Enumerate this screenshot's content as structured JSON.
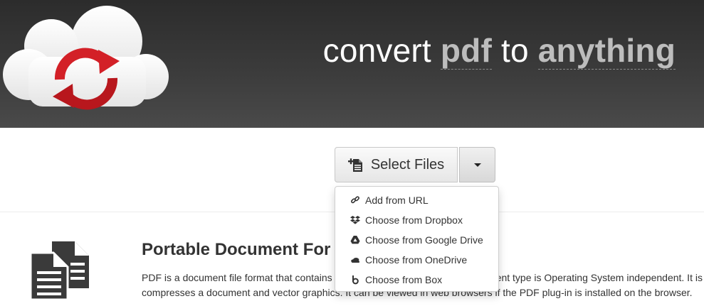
{
  "header": {
    "tagline_words": {
      "w1": "convert",
      "w2": "pdf",
      "w3": "to",
      "w4": "anything"
    },
    "colors": {
      "logo_red": "#d32027",
      "highlight_text": "#bdbdbd"
    }
  },
  "toolbar": {
    "select_files_label": "Select Files",
    "select_icon": "file-add-icon",
    "dropdown_icon": "caret-down-icon"
  },
  "dropdown": {
    "items": [
      {
        "label": "Add from URL",
        "icon": "link-icon"
      },
      {
        "label": "Choose from Dropbox",
        "icon": "dropbox-icon"
      },
      {
        "label": "Choose from Google Drive",
        "icon": "google-drive-icon"
      },
      {
        "label": "Choose from OneDrive",
        "icon": "onedrive-icon"
      },
      {
        "label": "Choose from Box",
        "icon": "box-icon"
      }
    ]
  },
  "content": {
    "title": "Portable Document For",
    "description_line1": "PDF is a document file format that contains",
    "description_line1_tail": "ent type is Operating System independent. It is",
    "description_line2_start": "compresses a document and vector graphics.",
    "description_line2": "It can be viewed in web browsers if the PDF plug-in is installed on the browser."
  }
}
